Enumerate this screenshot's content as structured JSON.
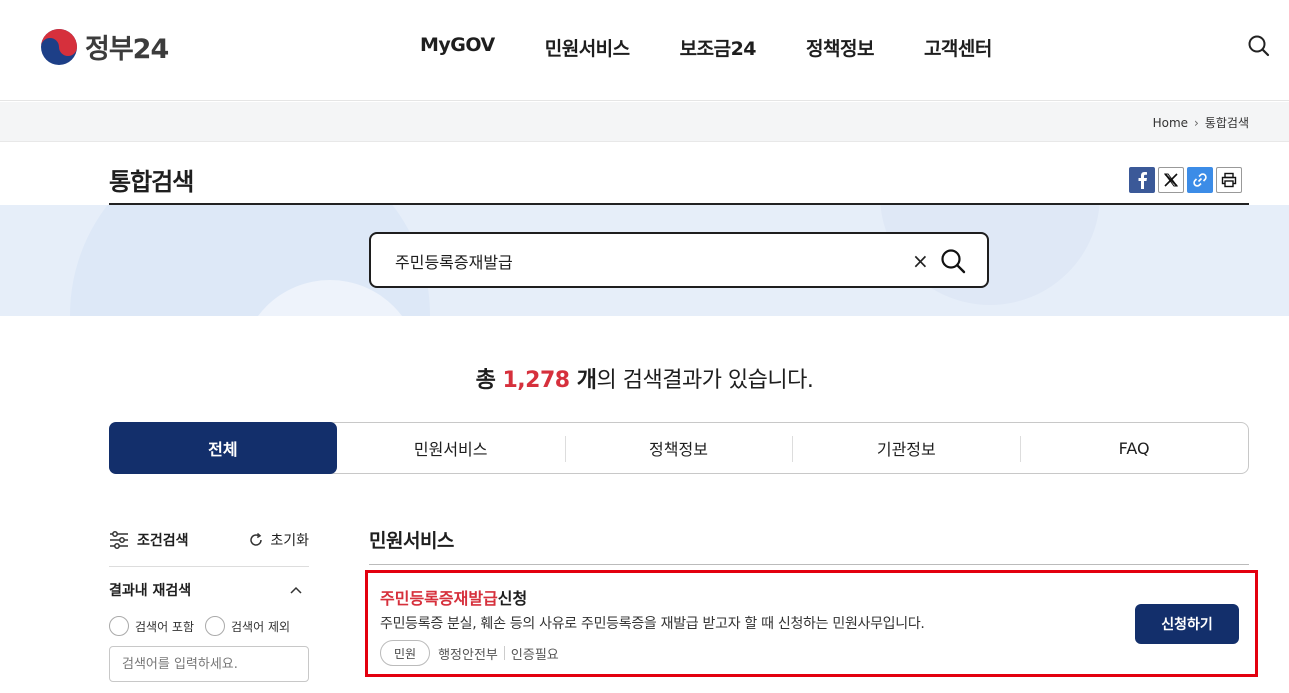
{
  "header": {
    "logo_text": "정부24",
    "nav": [
      "MyGOV",
      "민원서비스",
      "보조금24",
      "정책정보",
      "고객센터"
    ]
  },
  "breadcrumb": {
    "home": "Home",
    "current": "통합검색"
  },
  "page": {
    "title": "통합검색"
  },
  "share": {
    "icons": [
      "facebook-icon",
      "x-icon",
      "link-icon",
      "print-icon"
    ]
  },
  "search": {
    "value": "주민등록증재발급",
    "clear": "×"
  },
  "result": {
    "prefix": "총 ",
    "count": "1,278",
    "unit": " 개",
    "suffix": "의 검색결과가 있습니다."
  },
  "tabs": [
    "전체",
    "민원서비스",
    "정책정보",
    "기관정보",
    "FAQ"
  ],
  "sidebar": {
    "filter_label": "조건검색",
    "reset_label": "초기화",
    "research_label": "결과내 재검색",
    "include_label": "검색어 포함",
    "exclude_label": "검색어 제외",
    "input_placeholder": "검색어를 입력하세요."
  },
  "results": {
    "section_title": "민원서비스",
    "items": [
      {
        "title_highlight": "주민등록증재발급",
        "title_rest": "신청",
        "description": "주민등록증 분실, 훼손 등의 사유로 주민등록증을 재발급 받고자 할 때 신청하는 민원사무입니다.",
        "badge": "민원",
        "agency": "행정안전부",
        "auth": "인증필요",
        "button": "신청하기"
      }
    ]
  },
  "colors": {
    "primary": "#132f6b",
    "highlight": "#d6303c",
    "banner": "#e6eef9",
    "selection": "#e3000f"
  }
}
